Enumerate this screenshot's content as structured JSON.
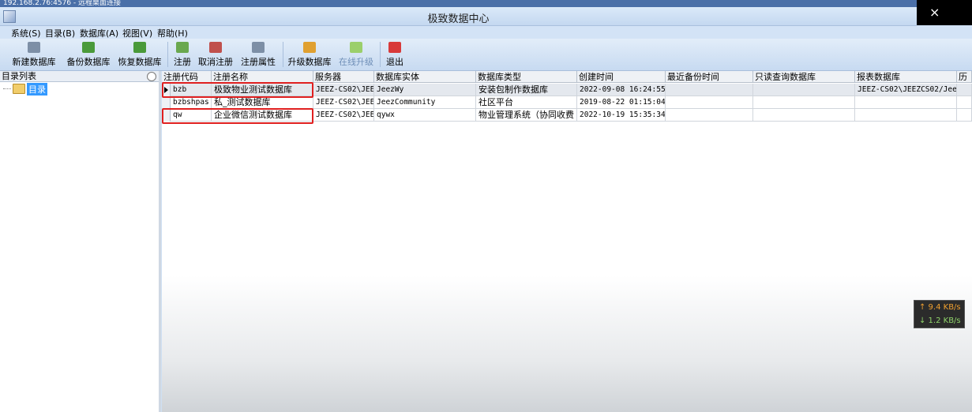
{
  "rdp": {
    "title": "192.168.2.76:4576 - 远程桌面连接"
  },
  "window": {
    "title": "极致数据中心"
  },
  "menu": [
    "系统(S)",
    "目录(B)",
    "数据库(A)",
    "视图(V)",
    "帮助(H)"
  ],
  "toolbar": [
    {
      "label": "新建数据库",
      "icon": "database-new-icon",
      "color": "#7d8fa6"
    },
    {
      "label": "备份数据库",
      "icon": "database-backup-icon",
      "color": "#4a9a3a"
    },
    {
      "label": "恢复数据库",
      "icon": "database-restore-icon",
      "color": "#4a9a3a"
    },
    {
      "label": "注册",
      "icon": "register-icon",
      "color": "#6aa84f"
    },
    {
      "label": "取消注册",
      "icon": "unregister-icon",
      "color": "#c0504d"
    },
    {
      "label": "注册属性",
      "icon": "properties-icon",
      "color": "#7d8fa6"
    },
    {
      "label": "升级数据库",
      "icon": "upgrade-database-icon",
      "color": "#e0a030"
    },
    {
      "label": "在线升级",
      "icon": "online-upgrade-icon",
      "color": "#9bcf6b"
    },
    {
      "label": "退出",
      "icon": "power-exit-icon",
      "color": "#d83a3a"
    }
  ],
  "left_pane": {
    "header": "目录列表",
    "root": "目录"
  },
  "grid": {
    "columns": [
      "注册代码",
      "注册名称",
      "服务器",
      "数据库实体",
      "数据库类型",
      "创建时间",
      "最近备份时间",
      "只读查询数据库",
      "报表数据库",
      "历"
    ],
    "rows": [
      [
        "bzb",
        "极致物业测试数据库",
        "JEEZ-CS02\\JEE",
        "JeezWy",
        "安装包制作数据库",
        "2022-09-08 16:24:55",
        "",
        "",
        "JEEZ-CS02\\JEEZCS02/Jee",
        ""
      ],
      [
        "bzbshpas",
        "私_测试数据库",
        "JEEZ-CS02\\JEE",
        "JeezCommunity",
        "社区平台",
        "2019-08-22 01:15:04",
        "",
        "",
        "",
        ""
      ],
      [
        "qw",
        "企业微信测试数据库",
        "JEEZ-CS02\\JEE",
        "qywx",
        "物业管理系统（协同收费",
        "2022-10-19 15:35:34",
        "",
        "",
        "",
        ""
      ]
    ]
  },
  "net": {
    "up": "↑ 9.4 KB/s",
    "down": "↓ 1.2 KB/s"
  },
  "colors": {
    "highlight": "#e02020",
    "selection": "#3399ff"
  }
}
